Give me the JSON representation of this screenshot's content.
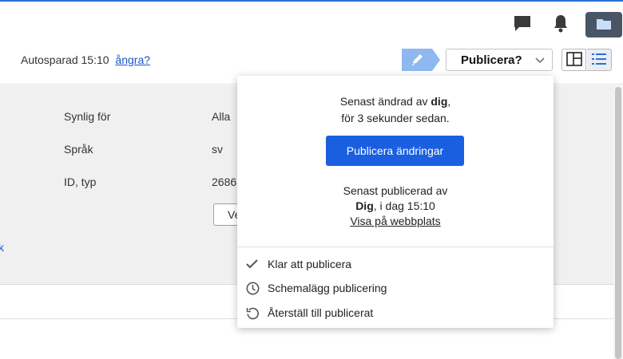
{
  "header": {
    "icons": [
      "chat-icon",
      "bell-icon",
      "folder-icon"
    ]
  },
  "toolbar": {
    "autosave_text": "Autosparad 15:10",
    "undo_label": "ångra?",
    "publish_select_label": "Publicera?",
    "view_icons": [
      "split-view-icon",
      "list-view-icon"
    ]
  },
  "properties": [
    {
      "label": "Synlig för",
      "value": "Alla"
    },
    {
      "label": "Språk",
      "value": "sv"
    },
    {
      "label": "ID, typ",
      "value": "2686"
    }
  ],
  "partial_button_label": "Ve",
  "edge_link_text": "k",
  "popover": {
    "changed_prefix": "Senast ändrad av ",
    "changed_by": "dig",
    "changed_suffix": ",",
    "changed_time": "för 3 sekunder sedan.",
    "publish_button": "Publicera ändringar",
    "published_line1": "Senast publicerad av",
    "published_by": "Dig",
    "published_time": ", i dag 15:10",
    "view_link": "Visa på webbplats",
    "items": [
      {
        "label": "Klar att publicera",
        "icon": "check-icon"
      },
      {
        "label": "Schemalägg publicering",
        "icon": "clock-icon"
      },
      {
        "label": "Återställ till publicerat",
        "icon": "revert-icon"
      }
    ]
  },
  "colors": {
    "accent": "#1a5fe0",
    "link": "#1a55c9",
    "edit_tag": "#8fb8f0",
    "panel_bg": "#f0f0f1"
  }
}
